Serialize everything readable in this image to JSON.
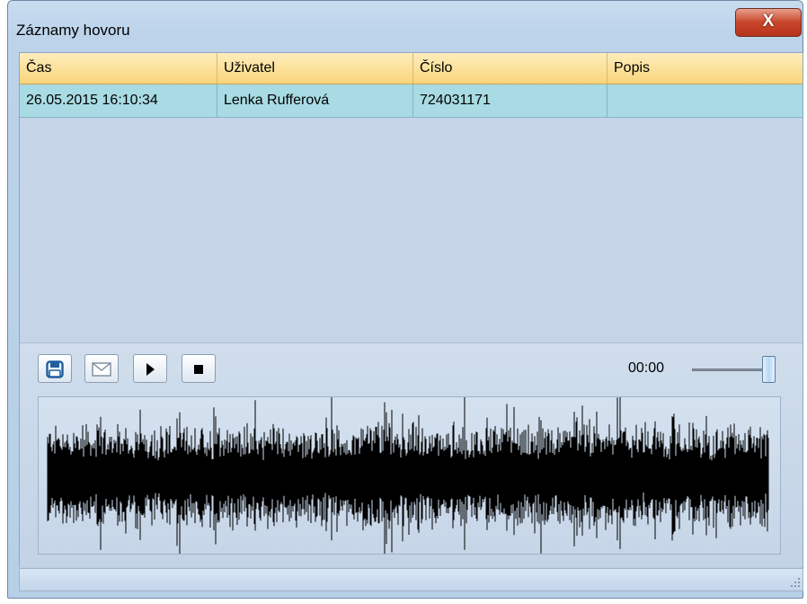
{
  "window": {
    "title": "Záznamy hovoru",
    "close_label": "X"
  },
  "grid": {
    "columns": [
      "Čas",
      "Uživatel",
      "Číslo",
      "Popis"
    ],
    "rows": [
      {
        "cas": "26.05.2015 16:10:34",
        "uzivatel": "Lenka Rufferová",
        "cislo": "724031171",
        "popis": ""
      }
    ]
  },
  "player": {
    "buttons": [
      "save-icon",
      "mail-icon",
      "play-icon",
      "stop-icon"
    ],
    "time": "00:00",
    "volume_level": 1.0
  },
  "colors": {
    "header": "#f9d57a",
    "selected_row": "#a8dbe3",
    "close": "#c8442a"
  }
}
